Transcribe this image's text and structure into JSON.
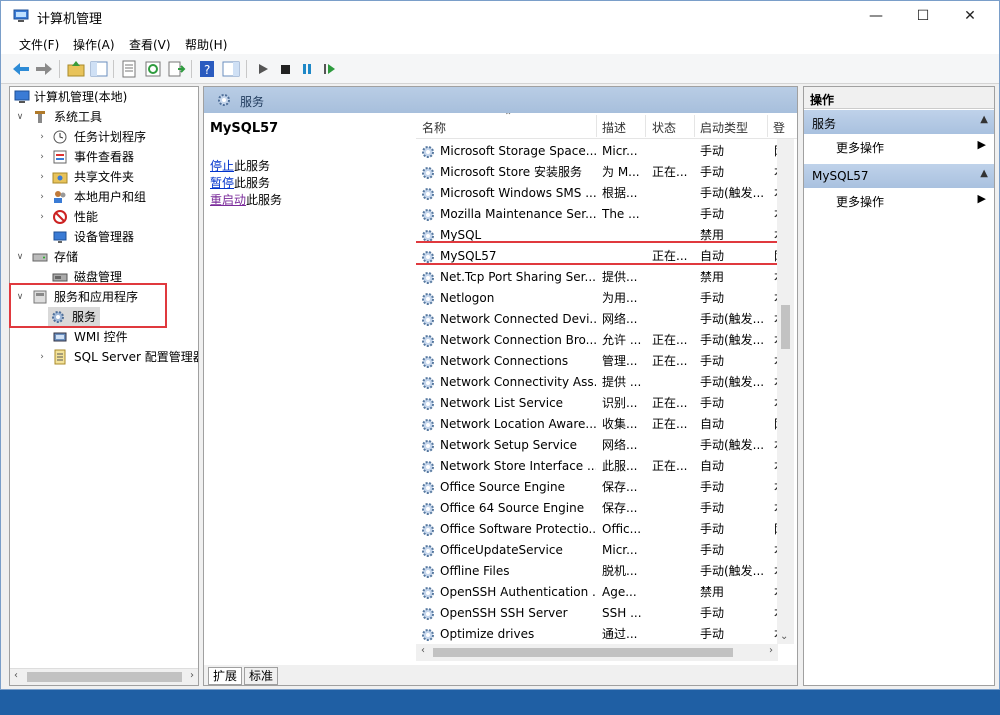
{
  "window": {
    "title": "计算机管理",
    "min_icon": "—",
    "max_icon": "☐",
    "close_icon": "✕"
  },
  "menu": [
    "文件(F)",
    "操作(A)",
    "查看(V)",
    "帮助(H)"
  ],
  "tree": {
    "root": "计算机管理(本地)",
    "system_tools": "系统工具",
    "task_scheduler": "任务计划程序",
    "event_viewer": "事件查看器",
    "shared_folders": "共享文件夹",
    "local_users": "本地用户和组",
    "performance": "性能",
    "device_manager": "设备管理器",
    "storage": "存储",
    "disk_management": "磁盘管理",
    "services_apps": "服务和应用程序",
    "services": "服务",
    "wmi": "WMI 控件",
    "sql_server": "SQL Server 配置管理器"
  },
  "center": {
    "header": "服务",
    "selected_service": "MySQL57",
    "actions": [
      {
        "link": "停止",
        "rest": "此服务"
      },
      {
        "link": "暂停",
        "rest": "此服务"
      },
      {
        "link": "重启动",
        "rest": "此服务"
      }
    ],
    "columns": {
      "name": "名称",
      "desc": "描述",
      "status": "状态",
      "startup": "启动类型",
      "logon": "登"
    },
    "services": [
      {
        "name": "Microsoft Storage Space...",
        "desc": "Micr...",
        "status": "",
        "startup": "手动",
        "logon": "网"
      },
      {
        "name": "Microsoft Store 安装服务",
        "desc": "为 M...",
        "status": "正在...",
        "startup": "手动",
        "logon": "本"
      },
      {
        "name": "Microsoft Windows SMS ...",
        "desc": "根据...",
        "status": "",
        "startup": "手动(触发...",
        "logon": "本"
      },
      {
        "name": "Mozilla Maintenance Ser...",
        "desc": "The ...",
        "status": "",
        "startup": "手动",
        "logon": "本"
      },
      {
        "name": "MySQL",
        "desc": "",
        "status": "",
        "startup": "禁用",
        "logon": "本"
      },
      {
        "name": "MySQL57",
        "desc": "",
        "status": "正在...",
        "startup": "自动",
        "logon": "网"
      },
      {
        "name": "Net.Tcp Port Sharing Ser...",
        "desc": "提供...",
        "status": "",
        "startup": "禁用",
        "logon": "本"
      },
      {
        "name": "Netlogon",
        "desc": "为用...",
        "status": "",
        "startup": "手动",
        "logon": "本"
      },
      {
        "name": "Network Connected Devi...",
        "desc": "网络...",
        "status": "",
        "startup": "手动(触发...",
        "logon": "本"
      },
      {
        "name": "Network Connection Bro...",
        "desc": "允许 ...",
        "status": "正在...",
        "startup": "手动(触发...",
        "logon": "本"
      },
      {
        "name": "Network Connections",
        "desc": "管理...",
        "status": "正在...",
        "startup": "手动",
        "logon": "本"
      },
      {
        "name": "Network Connectivity Ass...",
        "desc": "提供 ...",
        "status": "",
        "startup": "手动(触发...",
        "logon": "本"
      },
      {
        "name": "Network List Service",
        "desc": "识别...",
        "status": "正在...",
        "startup": "手动",
        "logon": "本"
      },
      {
        "name": "Network Location Aware...",
        "desc": "收集...",
        "status": "正在...",
        "startup": "自动",
        "logon": "网"
      },
      {
        "name": "Network Setup Service",
        "desc": "网络...",
        "status": "",
        "startup": "手动(触发...",
        "logon": "本"
      },
      {
        "name": "Network Store Interface ...",
        "desc": "此服...",
        "status": "正在...",
        "startup": "自动",
        "logon": "本"
      },
      {
        "name": "Office  Source Engine",
        "desc": "保存...",
        "status": "",
        "startup": "手动",
        "logon": "本"
      },
      {
        "name": "Office 64 Source Engine",
        "desc": "保存...",
        "status": "",
        "startup": "手动",
        "logon": "本"
      },
      {
        "name": "Office Software Protectio...",
        "desc": "Offic...",
        "status": "",
        "startup": "手动",
        "logon": "网"
      },
      {
        "name": "OfficeUpdateService",
        "desc": "Micr...",
        "status": "",
        "startup": "手动",
        "logon": "本"
      },
      {
        "name": "Offline Files",
        "desc": "脱机...",
        "status": "",
        "startup": "手动(触发...",
        "logon": "本"
      },
      {
        "name": "OpenSSH Authentication ...",
        "desc": "Age...",
        "status": "",
        "startup": "禁用",
        "logon": "本"
      },
      {
        "name": "OpenSSH SSH Server",
        "desc": "SSH ...",
        "status": "",
        "startup": "手动",
        "logon": "本"
      },
      {
        "name": "Optimize drives",
        "desc": "通过...",
        "status": "",
        "startup": "手动",
        "logon": "本"
      }
    ],
    "tabs": [
      "扩展",
      "标准"
    ]
  },
  "actions": {
    "title": "操作",
    "sections": [
      {
        "title": "服务",
        "item": "更多操作"
      },
      {
        "title": "MySQL57",
        "item": "更多操作"
      }
    ]
  },
  "colors": {
    "highlight": "#e0393e",
    "header_bg": "#b9cde5",
    "link": "#0033cc"
  }
}
